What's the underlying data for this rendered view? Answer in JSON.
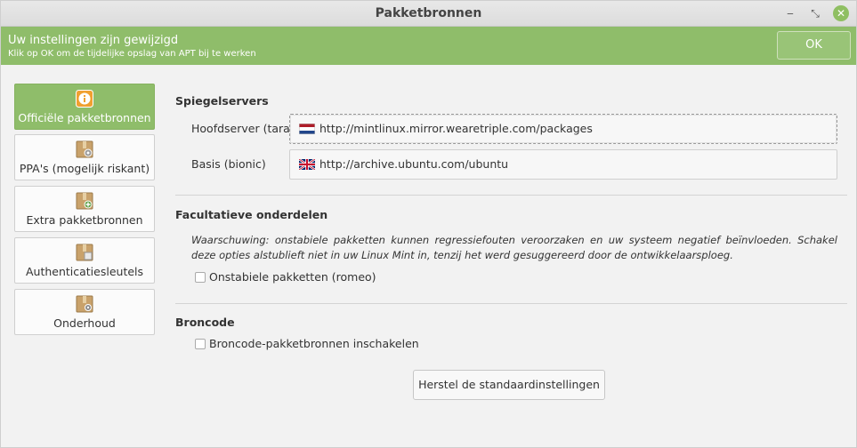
{
  "window": {
    "title": "Pakketbronnen",
    "controls": {
      "minimize": "‒",
      "maximize": "⤡",
      "close": "✕"
    }
  },
  "infobar": {
    "title": "Uw instellingen zijn gewijzigd",
    "subtitle": "Klik op OK om de tijdelijke opslag van APT bij te werken",
    "ok_label": "OK"
  },
  "sidebar": {
    "items": [
      {
        "label": "Officiële pakketbronnen",
        "icon": "info-icon",
        "active": true
      },
      {
        "label": "PPA's (mogelijk riskant)",
        "icon": "package-ppa-icon",
        "active": false
      },
      {
        "label": "Extra pakketbronnen",
        "icon": "package-add-icon",
        "active": false
      },
      {
        "label": "Authenticatiesleutels",
        "icon": "package-keys-icon",
        "active": false
      },
      {
        "label": "Onderhoud",
        "icon": "package-maintenance-icon",
        "active": false
      }
    ]
  },
  "mirrors": {
    "heading": "Spiegelservers",
    "main_label": "Hoofdserver (tara)",
    "main_url": "http://mintlinux.mirror.wearetriple.com/packages",
    "main_flag": "netherlands-flag-icon",
    "base_label": "Basis (bionic)",
    "base_url": "http://archive.ubuntu.com/ubuntu",
    "base_flag": "uk-flag-icon"
  },
  "optional": {
    "heading": "Facultatieve onderdelen",
    "warning": "Waarschuwing: onstabiele pakketten kunnen regressiefouten veroorzaken en uw systeem negatief beïnvloeden. Schakel deze opties alstublieft niet in uw Linux Mint in, tenzij het werd gesuggereerd door de ontwikkelaarsploeg.",
    "unstable_label": "Onstabiele pakketten (romeo)",
    "unstable_checked": false
  },
  "source": {
    "heading": "Broncode",
    "enable_label": "Broncode-pakketbronnen inschakelen",
    "enable_checked": false
  },
  "reset_label": "Herstel de standaardinstellingen",
  "colors": {
    "accent": "#8fbd6a",
    "background": "#f2f2f2",
    "package_icon": "#c9a26b",
    "info_icon": "#f0a030"
  }
}
